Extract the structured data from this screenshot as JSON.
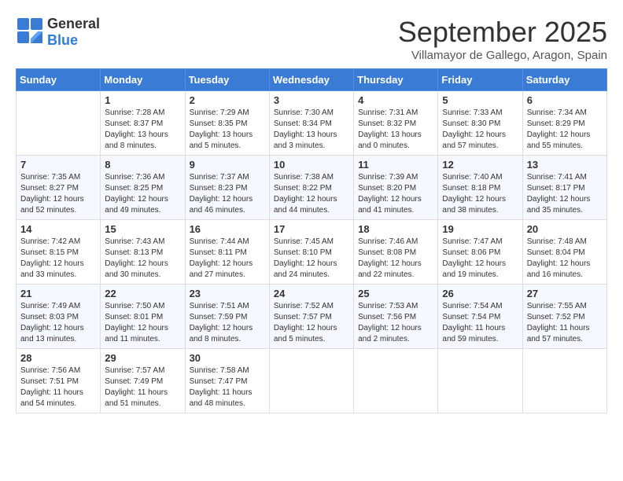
{
  "header": {
    "logo_general": "General",
    "logo_blue": "Blue",
    "month_title": "September 2025",
    "location": "Villamayor de Gallego, Aragon, Spain"
  },
  "weekdays": [
    "Sunday",
    "Monday",
    "Tuesday",
    "Wednesday",
    "Thursday",
    "Friday",
    "Saturday"
  ],
  "weeks": [
    [
      {
        "day": "",
        "sunrise": "",
        "sunset": "",
        "daylight": ""
      },
      {
        "day": "1",
        "sunrise": "Sunrise: 7:28 AM",
        "sunset": "Sunset: 8:37 PM",
        "daylight": "Daylight: 13 hours and 8 minutes."
      },
      {
        "day": "2",
        "sunrise": "Sunrise: 7:29 AM",
        "sunset": "Sunset: 8:35 PM",
        "daylight": "Daylight: 13 hours and 5 minutes."
      },
      {
        "day": "3",
        "sunrise": "Sunrise: 7:30 AM",
        "sunset": "Sunset: 8:34 PM",
        "daylight": "Daylight: 13 hours and 3 minutes."
      },
      {
        "day": "4",
        "sunrise": "Sunrise: 7:31 AM",
        "sunset": "Sunset: 8:32 PM",
        "daylight": "Daylight: 13 hours and 0 minutes."
      },
      {
        "day": "5",
        "sunrise": "Sunrise: 7:33 AM",
        "sunset": "Sunset: 8:30 PM",
        "daylight": "Daylight: 12 hours and 57 minutes."
      },
      {
        "day": "6",
        "sunrise": "Sunrise: 7:34 AM",
        "sunset": "Sunset: 8:29 PM",
        "daylight": "Daylight: 12 hours and 55 minutes."
      }
    ],
    [
      {
        "day": "7",
        "sunrise": "Sunrise: 7:35 AM",
        "sunset": "Sunset: 8:27 PM",
        "daylight": "Daylight: 12 hours and 52 minutes."
      },
      {
        "day": "8",
        "sunrise": "Sunrise: 7:36 AM",
        "sunset": "Sunset: 8:25 PM",
        "daylight": "Daylight: 12 hours and 49 minutes."
      },
      {
        "day": "9",
        "sunrise": "Sunrise: 7:37 AM",
        "sunset": "Sunset: 8:23 PM",
        "daylight": "Daylight: 12 hours and 46 minutes."
      },
      {
        "day": "10",
        "sunrise": "Sunrise: 7:38 AM",
        "sunset": "Sunset: 8:22 PM",
        "daylight": "Daylight: 12 hours and 44 minutes."
      },
      {
        "day": "11",
        "sunrise": "Sunrise: 7:39 AM",
        "sunset": "Sunset: 8:20 PM",
        "daylight": "Daylight: 12 hours and 41 minutes."
      },
      {
        "day": "12",
        "sunrise": "Sunrise: 7:40 AM",
        "sunset": "Sunset: 8:18 PM",
        "daylight": "Daylight: 12 hours and 38 minutes."
      },
      {
        "day": "13",
        "sunrise": "Sunrise: 7:41 AM",
        "sunset": "Sunset: 8:17 PM",
        "daylight": "Daylight: 12 hours and 35 minutes."
      }
    ],
    [
      {
        "day": "14",
        "sunrise": "Sunrise: 7:42 AM",
        "sunset": "Sunset: 8:15 PM",
        "daylight": "Daylight: 12 hours and 33 minutes."
      },
      {
        "day": "15",
        "sunrise": "Sunrise: 7:43 AM",
        "sunset": "Sunset: 8:13 PM",
        "daylight": "Daylight: 12 hours and 30 minutes."
      },
      {
        "day": "16",
        "sunrise": "Sunrise: 7:44 AM",
        "sunset": "Sunset: 8:11 PM",
        "daylight": "Daylight: 12 hours and 27 minutes."
      },
      {
        "day": "17",
        "sunrise": "Sunrise: 7:45 AM",
        "sunset": "Sunset: 8:10 PM",
        "daylight": "Daylight: 12 hours and 24 minutes."
      },
      {
        "day": "18",
        "sunrise": "Sunrise: 7:46 AM",
        "sunset": "Sunset: 8:08 PM",
        "daylight": "Daylight: 12 hours and 22 minutes."
      },
      {
        "day": "19",
        "sunrise": "Sunrise: 7:47 AM",
        "sunset": "Sunset: 8:06 PM",
        "daylight": "Daylight: 12 hours and 19 minutes."
      },
      {
        "day": "20",
        "sunrise": "Sunrise: 7:48 AM",
        "sunset": "Sunset: 8:04 PM",
        "daylight": "Daylight: 12 hours and 16 minutes."
      }
    ],
    [
      {
        "day": "21",
        "sunrise": "Sunrise: 7:49 AM",
        "sunset": "Sunset: 8:03 PM",
        "daylight": "Daylight: 12 hours and 13 minutes."
      },
      {
        "day": "22",
        "sunrise": "Sunrise: 7:50 AM",
        "sunset": "Sunset: 8:01 PM",
        "daylight": "Daylight: 12 hours and 11 minutes."
      },
      {
        "day": "23",
        "sunrise": "Sunrise: 7:51 AM",
        "sunset": "Sunset: 7:59 PM",
        "daylight": "Daylight: 12 hours and 8 minutes."
      },
      {
        "day": "24",
        "sunrise": "Sunrise: 7:52 AM",
        "sunset": "Sunset: 7:57 PM",
        "daylight": "Daylight: 12 hours and 5 minutes."
      },
      {
        "day": "25",
        "sunrise": "Sunrise: 7:53 AM",
        "sunset": "Sunset: 7:56 PM",
        "daylight": "Daylight: 12 hours and 2 minutes."
      },
      {
        "day": "26",
        "sunrise": "Sunrise: 7:54 AM",
        "sunset": "Sunset: 7:54 PM",
        "daylight": "Daylight: 11 hours and 59 minutes."
      },
      {
        "day": "27",
        "sunrise": "Sunrise: 7:55 AM",
        "sunset": "Sunset: 7:52 PM",
        "daylight": "Daylight: 11 hours and 57 minutes."
      }
    ],
    [
      {
        "day": "28",
        "sunrise": "Sunrise: 7:56 AM",
        "sunset": "Sunset: 7:51 PM",
        "daylight": "Daylight: 11 hours and 54 minutes."
      },
      {
        "day": "29",
        "sunrise": "Sunrise: 7:57 AM",
        "sunset": "Sunset: 7:49 PM",
        "daylight": "Daylight: 11 hours and 51 minutes."
      },
      {
        "day": "30",
        "sunrise": "Sunrise: 7:58 AM",
        "sunset": "Sunset: 7:47 PM",
        "daylight": "Daylight: 11 hours and 48 minutes."
      },
      {
        "day": "",
        "sunrise": "",
        "sunset": "",
        "daylight": ""
      },
      {
        "day": "",
        "sunrise": "",
        "sunset": "",
        "daylight": ""
      },
      {
        "day": "",
        "sunrise": "",
        "sunset": "",
        "daylight": ""
      },
      {
        "day": "",
        "sunrise": "",
        "sunset": "",
        "daylight": ""
      }
    ]
  ]
}
